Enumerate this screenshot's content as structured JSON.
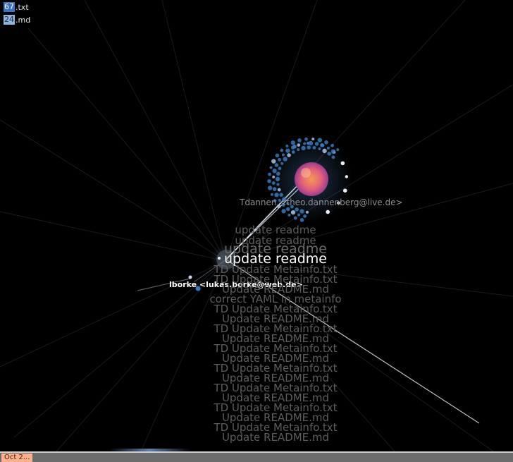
{
  "legend": [
    {
      "count": "67",
      "ext": ".txt",
      "color": "#3b73c9"
    },
    {
      "count": "24",
      "ext": ".md",
      "color": "#8fb2df"
    }
  ],
  "users": {
    "tdannen": "Tdannen <theo.dannenberg@live.de>",
    "lborke": "lborke <lukas.borke@web.de>"
  },
  "commits": {
    "current": "update readme",
    "history": [
      "update readme",
      "update readme",
      "update readme",
      "TD Update Metainfo.txt",
      "TD Update Metainfo.txt",
      "Update README.md",
      "correct YAML in metainfo",
      "TD Update Metainfo.txt",
      "Update README.md",
      "TD Update Metainfo.txt",
      "Update README.md",
      "TD Update Metainfo.txt",
      "Update README.md",
      "TD Update Metainfo.txt",
      "Update README.md",
      "TD Update Metainfo.txt",
      "Update README.md",
      "TD Update Metainfo.txt",
      "Update README.md",
      "TD Update Metainfo.txt",
      "Update README.md"
    ]
  },
  "timeline": {
    "date": "Oct 2..."
  },
  "colors": {
    "background": "#000000",
    "file_node": "#3a78b8",
    "highlight": "#ffffff",
    "avatar_warm": "#ef7a55",
    "avatar_cool": "#b04a9a"
  }
}
